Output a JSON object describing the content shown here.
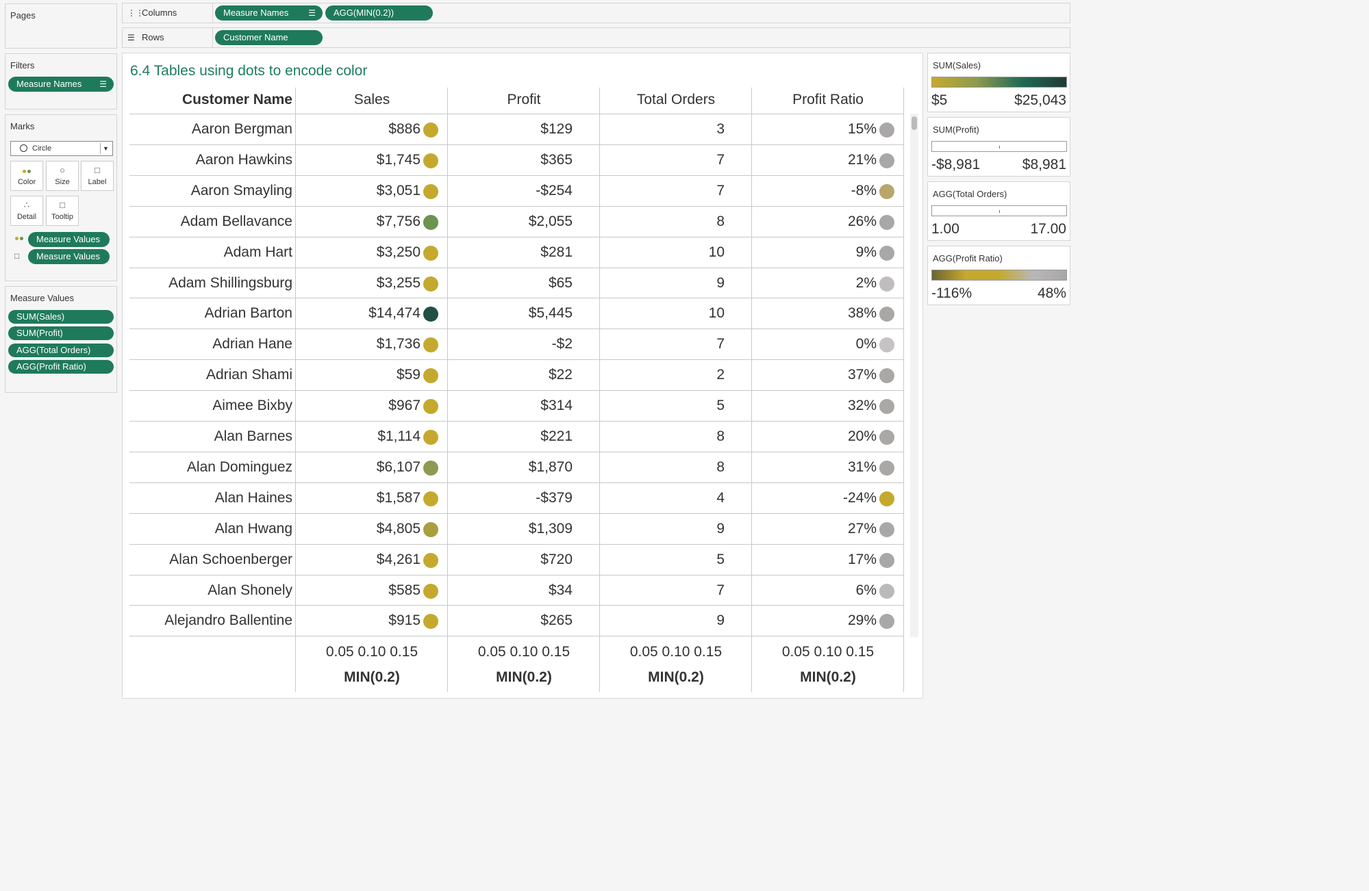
{
  "shelves": {
    "pages_label": "Pages",
    "columns_label": "Columns",
    "rows_label": "Rows",
    "columns_pills": [
      "Measure Names",
      "AGG(MIN(0.2))"
    ],
    "rows_pills": [
      "Customer Name"
    ]
  },
  "filters": {
    "title": "Filters",
    "pill": "Measure Names"
  },
  "marks": {
    "title": "Marks",
    "type": "Circle",
    "buttons": [
      "Color",
      "Size",
      "Label",
      "Detail",
      "Tooltip"
    ],
    "color_pill": "Measure Values",
    "label_pill": "Measure Values"
  },
  "measure_values": {
    "title": "Measure Values",
    "pills": [
      "SUM(Sales)",
      "SUM(Profit)",
      "AGG(Total Orders)",
      "AGG(Profit Ratio)"
    ]
  },
  "viz": {
    "title": "6.4 Tables using dots to encode color",
    "row_header": "Customer Name",
    "columns": [
      "Sales",
      "Profit",
      "Total Orders",
      "Profit Ratio"
    ],
    "rows": [
      {
        "name": "Aaron Bergman",
        "sales": "$886",
        "profit": "$129",
        "orders": "3",
        "ratio": "15%",
        "sales_color": "#c5a92e",
        "ratio_color": "#aaa7a7"
      },
      {
        "name": "Aaron Hawkins",
        "sales": "$1,745",
        "profit": "$365",
        "orders": "7",
        "ratio": "21%",
        "sales_color": "#c5a92e",
        "ratio_color": "#aaa7a7"
      },
      {
        "name": "Aaron Smayling",
        "sales": "$3,051",
        "profit": "-$254",
        "orders": "7",
        "ratio": "-8%",
        "sales_color": "#c5a92e",
        "ratio_color": "#b8a76a"
      },
      {
        "name": "Adam Bellavance",
        "sales": "$7,756",
        "profit": "$2,055",
        "orders": "8",
        "ratio": "26%",
        "sales_color": "#6a9450",
        "ratio_color": "#aaa7a7"
      },
      {
        "name": "Adam Hart",
        "sales": "$3,250",
        "profit": "$281",
        "orders": "10",
        "ratio": "9%",
        "sales_color": "#c5a92e",
        "ratio_color": "#aaa7a7"
      },
      {
        "name": "Adam Shillingsburg",
        "sales": "$3,255",
        "profit": "$65",
        "orders": "9",
        "ratio": "2%",
        "sales_color": "#c5a92e",
        "ratio_color": "#c0bdbd"
      },
      {
        "name": "Adrian Barton",
        "sales": "$14,474",
        "profit": "$5,445",
        "orders": "10",
        "ratio": "38%",
        "sales_color": "#1f4f45",
        "ratio_color": "#aaa7a7"
      },
      {
        "name": "Adrian Hane",
        "sales": "$1,736",
        "profit": "-$2",
        "orders": "7",
        "ratio": "0%",
        "sales_color": "#c5a92e",
        "ratio_color": "#c5c3c3"
      },
      {
        "name": "Adrian Shami",
        "sales": "$59",
        "profit": "$22",
        "orders": "2",
        "ratio": "37%",
        "sales_color": "#c5a92e",
        "ratio_color": "#aaa7a7"
      },
      {
        "name": "Aimee Bixby",
        "sales": "$967",
        "profit": "$314",
        "orders": "5",
        "ratio": "32%",
        "sales_color": "#c5a92e",
        "ratio_color": "#aaa7a7"
      },
      {
        "name": "Alan Barnes",
        "sales": "$1,114",
        "profit": "$221",
        "orders": "8",
        "ratio": "20%",
        "sales_color": "#c5a92e",
        "ratio_color": "#aaa7a7"
      },
      {
        "name": "Alan Dominguez",
        "sales": "$6,107",
        "profit": "$1,870",
        "orders": "8",
        "ratio": "31%",
        "sales_color": "#8e9a4f",
        "ratio_color": "#aaa7a7"
      },
      {
        "name": "Alan Haines",
        "sales": "$1,587",
        "profit": "-$379",
        "orders": "4",
        "ratio": "-24%",
        "sales_color": "#c5a92e",
        "ratio_color": "#c4aa2c"
      },
      {
        "name": "Alan Hwang",
        "sales": "$4,805",
        "profit": "$1,309",
        "orders": "9",
        "ratio": "27%",
        "sales_color": "#a99f3f",
        "ratio_color": "#aaa7a7"
      },
      {
        "name": "Alan Schoenberger",
        "sales": "$4,261",
        "profit": "$720",
        "orders": "5",
        "ratio": "17%",
        "sales_color": "#c5a92e",
        "ratio_color": "#aaa7a7"
      },
      {
        "name": "Alan Shonely",
        "sales": "$585",
        "profit": "$34",
        "orders": "7",
        "ratio": "6%",
        "sales_color": "#c5a92e",
        "ratio_color": "#bcb9b9"
      },
      {
        "name": "Alejandro Ballentine",
        "sales": "$915",
        "profit": "$265",
        "orders": "9",
        "ratio": "29%",
        "sales_color": "#c5a92e",
        "ratio_color": "#aaa7a7"
      }
    ],
    "axis_ticks": "0.05 0.10 0.15",
    "axis_title": "MIN(0.2)"
  },
  "legends": [
    {
      "title": "SUM(Sales)",
      "min": "$5",
      "max": "$25,043",
      "kind": "gradient",
      "colors": [
        "#c5a92e",
        "#8e9a4f",
        "#1f6a55",
        "#1f3a35"
      ]
    },
    {
      "title": "SUM(Profit)",
      "min": "-$8,981",
      "max": "$8,981",
      "kind": "empty"
    },
    {
      "title": "AGG(Total Orders)",
      "min": "1.00",
      "max": "17.00",
      "kind": "empty"
    },
    {
      "title": "AGG(Profit Ratio)",
      "min": "-116%",
      "max": "48%",
      "kind": "gradient",
      "colors": [
        "#6b6430",
        "#c5a92e",
        "#c5a92e",
        "#b9b7b7",
        "#a9a6a6"
      ]
    }
  ]
}
